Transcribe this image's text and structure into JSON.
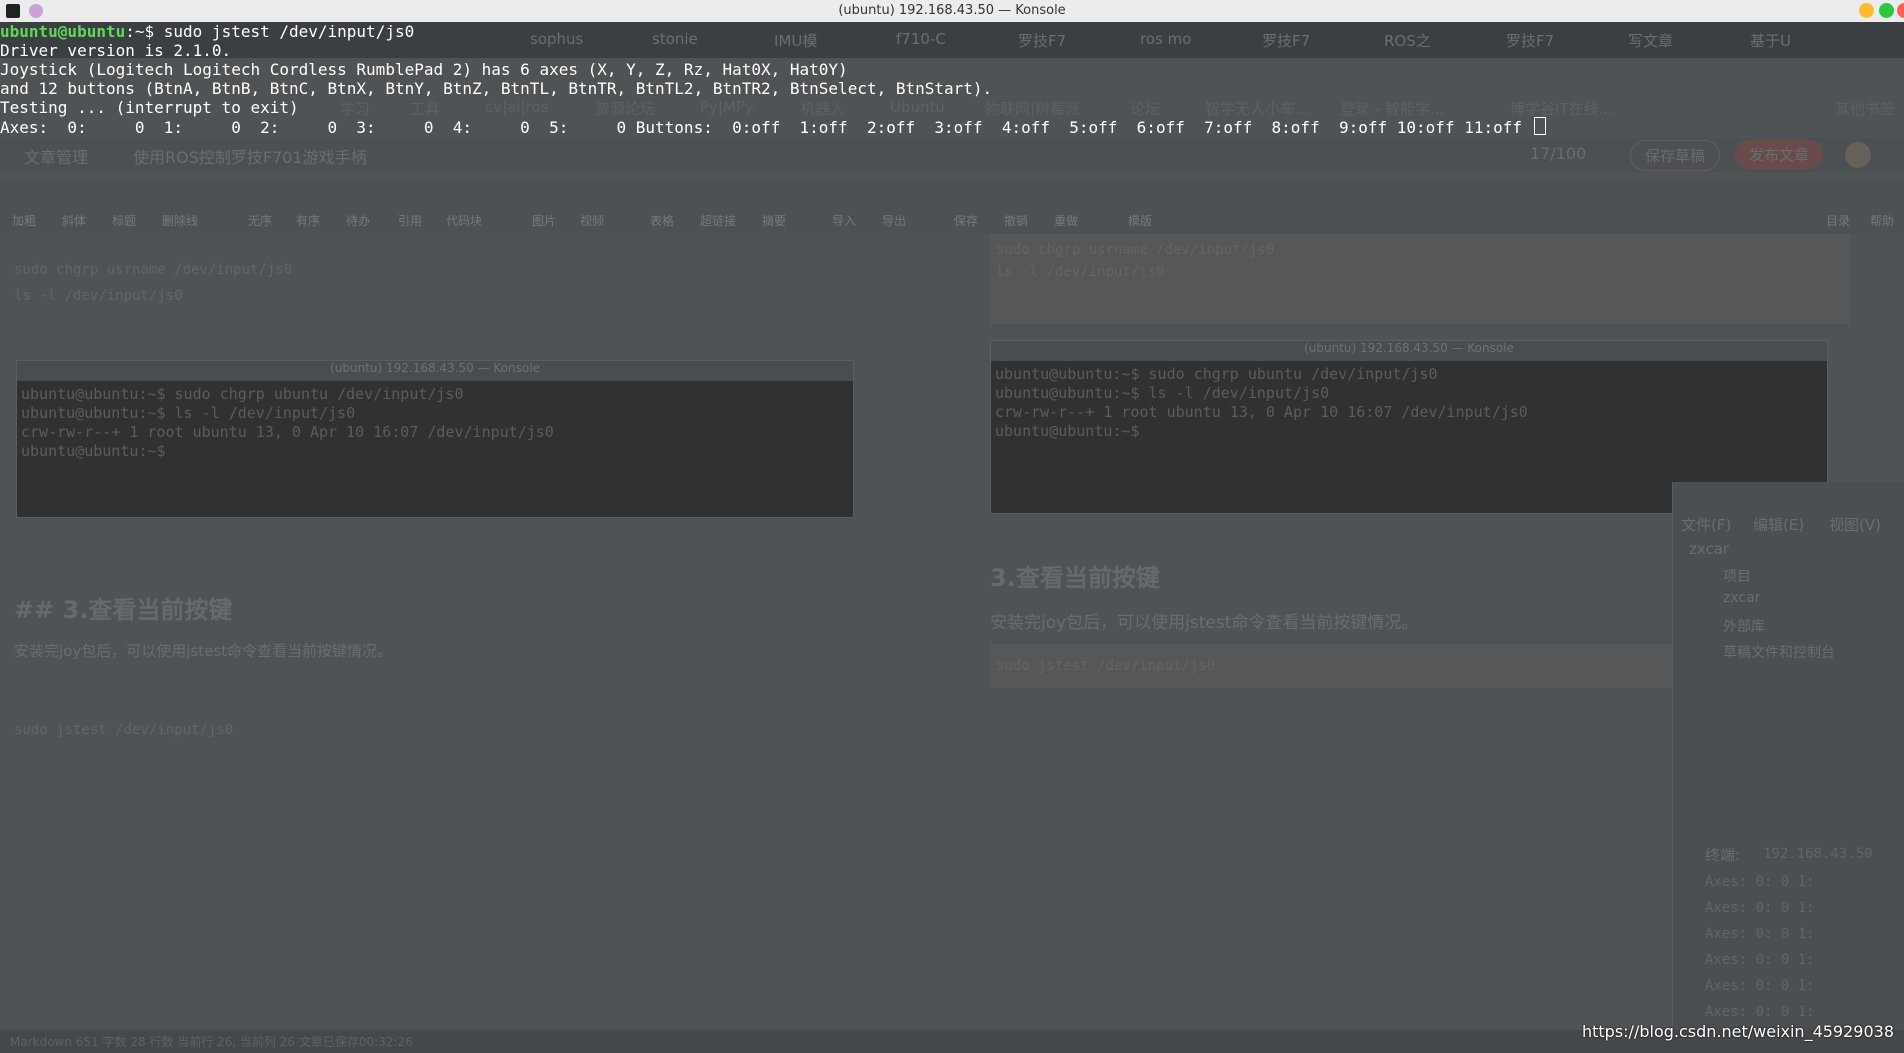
{
  "window": {
    "title": "(ubuntu) 192.168.43.50 — Konsole"
  },
  "terminal": {
    "prompt": "ubuntu@ubuntu",
    "prompt_suffix": ":~$ ",
    "command": "sudo jstest /dev/input/js0",
    "lines": [
      "Driver version is 2.1.0.",
      "Joystick (Logitech Logitech Cordless RumblePad 2) has 6 axes (X, Y, Z, Rz, Hat0X, Hat0Y)",
      "and 12 buttons (BtnA, BtnB, BtnC, BtnX, BtnY, BtnZ, BtnTL, BtnTR, BtnTL2, BtnTR2, BtnSelect, BtnStart).",
      "Testing ... (interrupt to exit)",
      "Axes:  0:     0  1:     0  2:     0  3:     0  4:     0  5:     0 Buttons:  0:off  1:off  2:off  3:off  4:off  5:off  6:off  7:off  8:off  9:off 10:off 11:off "
    ]
  },
  "background": {
    "tabs": [
      "sophus",
      "stonie",
      "IMU模",
      "f710-C",
      "罗技F7",
      "ros mo",
      "罗技F7",
      "ROS之",
      "罗技F7",
      "写文章",
      "基于U"
    ],
    "bookmarks": [
      "学习",
      "工具",
      "cv|ai|ros",
      "资源论坛",
      "Py|MPy",
      "机器人",
      "Ubuntu",
      "物联网|树莓派",
      "论坛",
      "智学无人小车...",
      "登录 - 智能学...",
      "博学谷IT在线...",
      "其他书签"
    ],
    "editor_header": {
      "back": "文章管理",
      "title": "使用ROS控制罗技F701游戏手柄",
      "count": "17/100",
      "save_draft": "保存草稿",
      "publish": "发布文章"
    },
    "toolbar": [
      "加粗",
      "斜体",
      "标题",
      "删除线",
      "无序",
      "有序",
      "待办",
      "引用",
      "代码块",
      "图片",
      "视频",
      "表格",
      "超链接",
      "摘要",
      "导入",
      "导出",
      "保存",
      "撤销",
      "重做",
      "模版",
      "目录",
      "帮助"
    ],
    "left_code": [
      "sudo chgrp usrname /dev/input/js0",
      "ls -l /dev/input/js0"
    ],
    "right_code": [
      "sudo chgrp usrname /dev/input/js0",
      "ls -l /dev/input/js0"
    ],
    "inner_terminal_title": "(ubuntu) 192.168.43.50 — Konsole",
    "inner_terminal_lines": [
      "ubuntu@ubuntu:~$ sudo chgrp ubuntu /dev/input/js0",
      "ubuntu@ubuntu:~$ ls -l /dev/input/js0",
      "crw-rw-r--+ 1 root ubuntu 13, 0 Apr 10 16:07 /dev/input/js0",
      "ubuntu@ubuntu:~$ "
    ],
    "heading": "3.查看当前按键",
    "left_heading": "## 3.查看当前按键",
    "paragraph": "安装完joy包后，可以使用jstest命令查看当前按键情况。",
    "command_code": "sudo jstest /dev/input/js0",
    "side_menu": [
      "文件(F)",
      "编辑(E)",
      "视图(V)"
    ],
    "side_tree": [
      "zxcar",
      "项目",
      "zxcar",
      "外部库",
      "草稿文件和控制台"
    ],
    "side_terminal_label": "终端:",
    "side_terminal_tab": "192.168.43.50",
    "side_axes": [
      "Axes:  0:     0  1:",
      "Axes:  0:     0  1:",
      "Axes:  0:     0  1:",
      "Axes:  0:     0  1:",
      "Axes:  0:     0  1:",
      "Axes:  0:     0  1:"
    ],
    "status": "Markdown  651 字数  28 行数  当前行 26, 当前列 26  文章已保存00:32:26"
  },
  "watermark": "https://blog.csdn.net/weixin_45929038",
  "colors": {
    "prompt": "#5fd75f",
    "text": "#ffffff",
    "close": "#ff5f57",
    "min": "#febc2e",
    "max": "#28c840"
  }
}
